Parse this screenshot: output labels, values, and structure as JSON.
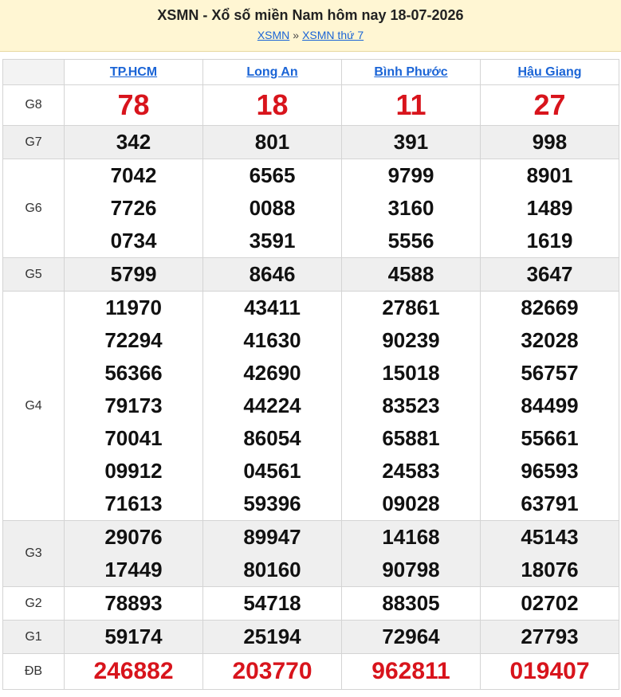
{
  "header": {
    "title": "XSMN - Xổ số miền Nam hôm nay 18-07-2026",
    "breadcrumb": [
      {
        "label": "XSMN"
      },
      {
        "label": "XSMN thứ 7"
      }
    ],
    "separator": "»"
  },
  "provinces": [
    "TP.HCM",
    "Long An",
    "Bình Phước",
    "Hậu Giang"
  ],
  "prizes": [
    {
      "label": "G8",
      "style": "big",
      "alt": false,
      "values": [
        [
          "78"
        ],
        [
          "18"
        ],
        [
          "11"
        ],
        [
          "27"
        ]
      ]
    },
    {
      "label": "G7",
      "style": "normal",
      "alt": true,
      "values": [
        [
          "342"
        ],
        [
          "801"
        ],
        [
          "391"
        ],
        [
          "998"
        ]
      ]
    },
    {
      "label": "G6",
      "style": "normal",
      "alt": false,
      "values": [
        [
          "7042",
          "7726",
          "0734"
        ],
        [
          "6565",
          "0088",
          "3591"
        ],
        [
          "9799",
          "3160",
          "5556"
        ],
        [
          "8901",
          "1489",
          "1619"
        ]
      ]
    },
    {
      "label": "G5",
      "style": "normal",
      "alt": true,
      "values": [
        [
          "5799"
        ],
        [
          "8646"
        ],
        [
          "4588"
        ],
        [
          "3647"
        ]
      ]
    },
    {
      "label": "G4",
      "style": "normal",
      "alt": false,
      "values": [
        [
          "11970",
          "72294",
          "56366",
          "79173",
          "70041",
          "09912",
          "71613"
        ],
        [
          "43411",
          "41630",
          "42690",
          "44224",
          "86054",
          "04561",
          "59396"
        ],
        [
          "27861",
          "90239",
          "15018",
          "83523",
          "65881",
          "24583",
          "09028"
        ],
        [
          "82669",
          "32028",
          "56757",
          "84499",
          "55661",
          "96593",
          "63791"
        ]
      ]
    },
    {
      "label": "G3",
      "style": "normal",
      "alt": true,
      "values": [
        [
          "29076",
          "17449"
        ],
        [
          "89947",
          "80160"
        ],
        [
          "14168",
          "90798"
        ],
        [
          "45143",
          "18076"
        ]
      ]
    },
    {
      "label": "G2",
      "style": "normal",
      "alt": false,
      "values": [
        [
          "78893"
        ],
        [
          "54718"
        ],
        [
          "88305"
        ],
        [
          "02702"
        ]
      ]
    },
    {
      "label": "G1",
      "style": "normal",
      "alt": true,
      "values": [
        [
          "59174"
        ],
        [
          "25194"
        ],
        [
          "72964"
        ],
        [
          "27793"
        ]
      ]
    },
    {
      "label": "ĐB",
      "style": "db",
      "alt": false,
      "values": [
        [
          "246882"
        ],
        [
          "203770"
        ],
        [
          "962811"
        ],
        [
          "019407"
        ]
      ]
    }
  ],
  "colors": {
    "header_bg": "#fff6d3",
    "link": "#1a64d6",
    "highlight_number": "#d8141c",
    "alt_row": "#efefef"
  }
}
